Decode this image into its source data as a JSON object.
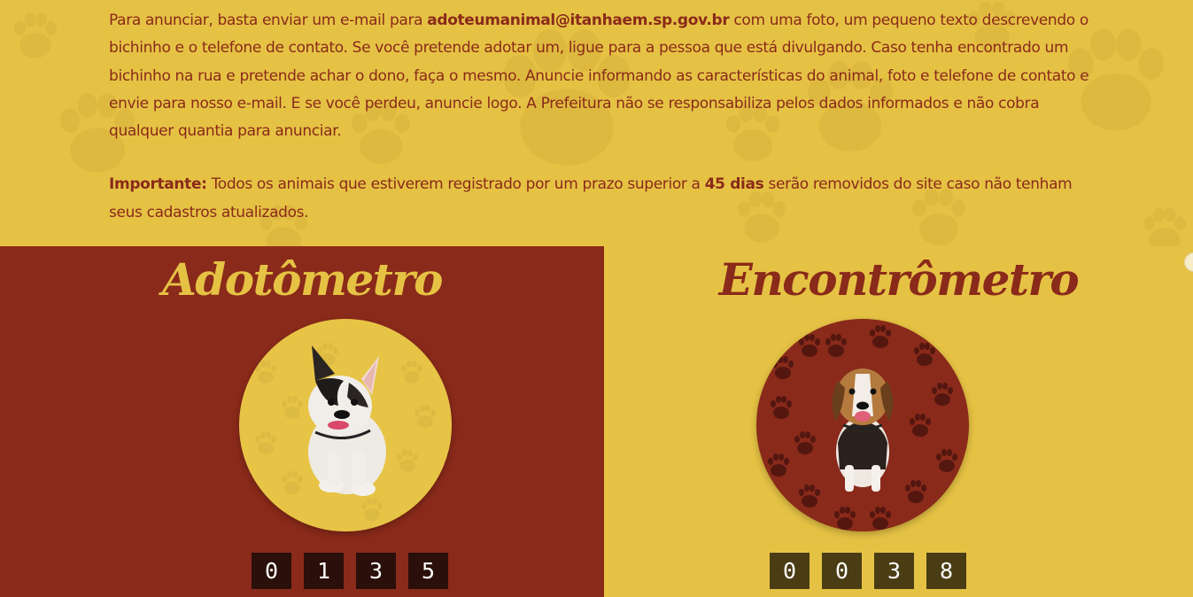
{
  "intro": {
    "p1_prefix": "Para anunciar, basta enviar um e-mail para ",
    "email": "adoteumanimal@itanhaem.sp.gov.br",
    "p1_suffix": " com uma foto, um pequeno texto descrevendo o bichinho e o telefone de contato. Se você pretende adotar um, ligue para a pessoa que está divulgando. Caso tenha encontrado um bichinho na rua e pretende achar o dono, faça o mesmo. Anuncie informando as características do animal, foto e telefone de contato e envie para nosso e-mail. E se você perdeu, anuncie logo. A Prefeitura não se responsabiliza pelos dados informados e não cobra qualquer quantia para anunciar.",
    "important_label": "Importante:",
    "p2_prefix": " Todos os animais que estiverem registrado por um prazo superior a ",
    "days": "45 dias",
    "p2_suffix": " serão removidos do site caso não tenham seus cadastros atualizados."
  },
  "adotometro": {
    "title": "Adotômetro",
    "digits": [
      "0",
      "1",
      "3",
      "5"
    ]
  },
  "encontrometro": {
    "title": "Encontrômetro",
    "digits": [
      "0",
      "0",
      "3",
      "8"
    ]
  },
  "colors": {
    "yellow": "#e5c244",
    "dark_red": "#8a2a1a"
  }
}
